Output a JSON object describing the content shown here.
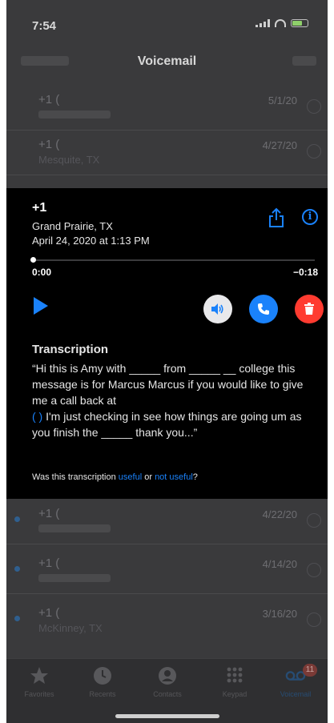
{
  "status_bar": {
    "time": "7:54"
  },
  "nav": {
    "title": "Voicemail"
  },
  "list_top": [
    {
      "name": "+1 (",
      "sub": "",
      "date": "5/1/20",
      "time": ""
    },
    {
      "name": "+1 (",
      "sub": "Mesquite, TX",
      "date": "4/27/20",
      "time": ""
    }
  ],
  "expanded": {
    "number": "+1",
    "location": "Grand Prairie, TX",
    "datetime": "April 24, 2020 at 1:13 PM",
    "elapsed": "0:00",
    "remaining": "−0:18",
    "transcription_title": "Transcription",
    "transcription": {
      "part1": "“Hi this is Amy with _____ from _____ __ college this message is for Marcus Marcus if you would like to give me a call back at",
      "phone_fragment": "(                    )",
      "part2": " I'm just checking in see how things are going um as you finish the _____ thank you...”"
    },
    "feedback": {
      "prefix": "Was this transcription ",
      "useful": "useful",
      "or": " or ",
      "not_useful": "not useful",
      "suffix": "?"
    }
  },
  "list_bottom": [
    {
      "name": "+1 (",
      "sub": "",
      "date": "4/22/20",
      "time": ""
    },
    {
      "name": "+1 (",
      "sub": "",
      "date": "4/14/20",
      "time": ""
    },
    {
      "name": "+1 (",
      "sub": "McKinney, TX",
      "date": "3/16/20",
      "time": ""
    }
  ],
  "tabs": [
    {
      "label": "Favorites",
      "icon": "star-icon"
    },
    {
      "label": "Recents",
      "icon": "clock-icon"
    },
    {
      "label": "Contacts",
      "icon": "person-icon"
    },
    {
      "label": "Keypad",
      "icon": "keypad-icon"
    },
    {
      "label": "Voicemail",
      "icon": "voicemail-icon",
      "badge": "11"
    }
  ]
}
